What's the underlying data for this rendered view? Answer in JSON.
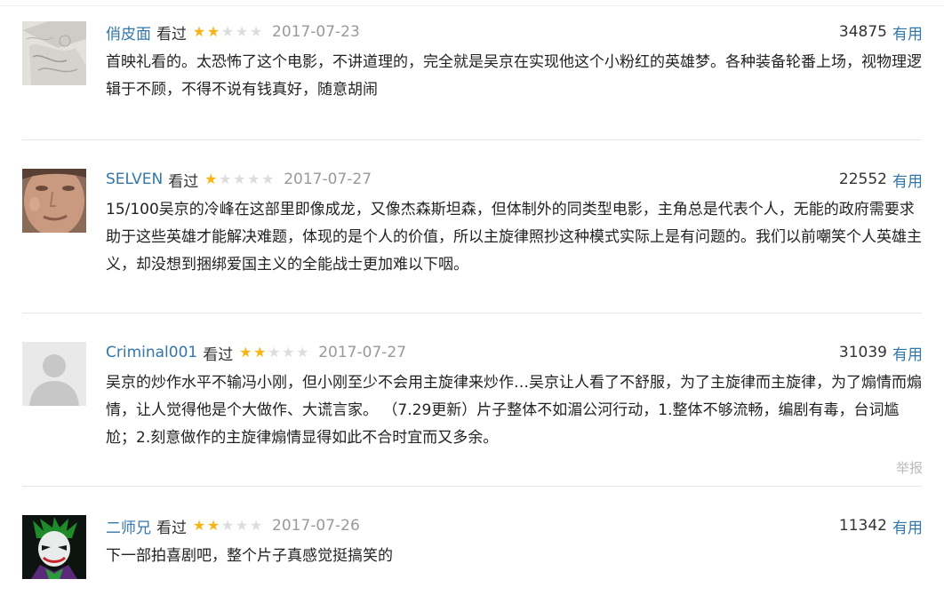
{
  "colors": {
    "link": "#3377aa",
    "star_on": "#f7b515",
    "star_off": "#dddddd",
    "muted": "#999999"
  },
  "comments": [
    {
      "username": "俏皮面",
      "status": "看过",
      "rating": 2,
      "date": "2017-07-23",
      "votes": "34875",
      "useful_label": "有用",
      "text": "首映礼看的。太恐怖了这个电影，不讲道理的，完全就是吴京在实现他这个小粉红的英雄梦。各种装备轮番上场，视物理逻辑于不顾，不得不说有钱真好，随意胡闹"
    },
    {
      "username": "SELVEN",
      "status": "看过",
      "rating": 1,
      "date": "2017-07-27",
      "votes": "22552",
      "useful_label": "有用",
      "text": "15/100吴京的冷峰在这部里即像成龙，又像杰森斯坦森，但体制外的同类型电影，主角总是代表个人，无能的政府需要求助于这些英雄才能解决难题，体现的是个人的价值，所以主旋律照抄这种模式实际上是有问题的。我们以前嘲笑个人英雄主义，却没想到捆绑爱国主义的全能战士更加难以下咽。"
    },
    {
      "username": "Criminal001",
      "status": "看过",
      "rating": 2,
      "date": "2017-07-27",
      "votes": "31039",
      "useful_label": "有用",
      "text": "吴京的炒作水平不输冯小刚，但小刚至少不会用主旋律来炒作…吴京让人看了不舒服，为了主旋律而主旋律，为了煽情而煽情，让人觉得他是个大做作、大谎言家。 （7.29更新）片子整体不如湄公河行动，1.整体不够流畅，编剧有毒，台词尴尬；2.刻意做作的主旋律煽情显得如此不合时宜而又多余。",
      "report_label": "举报"
    },
    {
      "username": "二师兄",
      "status": "看过",
      "rating": 2,
      "date": "2017-07-26",
      "votes": "11342",
      "useful_label": "有用",
      "text": "下一部拍喜剧吧，整个片子真感觉挺搞笑的"
    }
  ]
}
